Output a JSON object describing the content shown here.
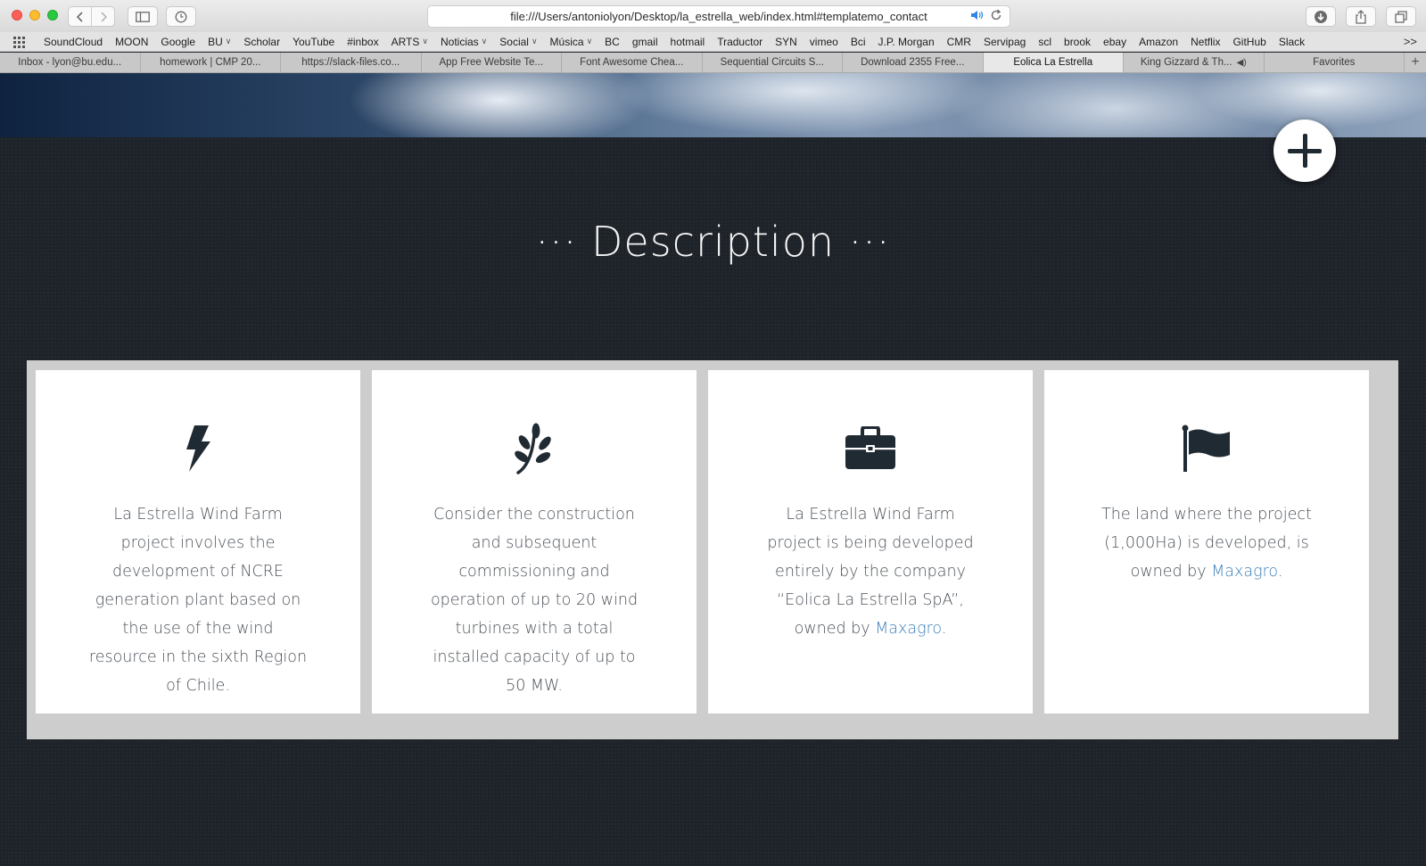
{
  "browser": {
    "url": "file:///Users/antoniolyon/Desktop/la_estrella_web/index.html#templatemo_contact",
    "bookmarks": [
      {
        "label": "SoundCloud",
        "menu": false
      },
      {
        "label": "MOON",
        "menu": false
      },
      {
        "label": "Google",
        "menu": false
      },
      {
        "label": "BU",
        "menu": true
      },
      {
        "label": "Scholar",
        "menu": false
      },
      {
        "label": "YouTube",
        "menu": false
      },
      {
        "label": "#inbox",
        "menu": false
      },
      {
        "label": "ARTS",
        "menu": true
      },
      {
        "label": "Noticias",
        "menu": true
      },
      {
        "label": "Social",
        "menu": true
      },
      {
        "label": "Música",
        "menu": true
      },
      {
        "label": "BC",
        "menu": false
      },
      {
        "label": "gmail",
        "menu": false
      },
      {
        "label": "hotmail",
        "menu": false
      },
      {
        "label": "Traductor",
        "menu": false
      },
      {
        "label": "SYN",
        "menu": false
      },
      {
        "label": "vimeo",
        "menu": false
      },
      {
        "label": "Bci",
        "menu": false
      },
      {
        "label": "J.P. Morgan",
        "menu": false
      },
      {
        "label": "CMR",
        "menu": false
      },
      {
        "label": "Servipag",
        "menu": false
      },
      {
        "label": "scl",
        "menu": false
      },
      {
        "label": "brook",
        "menu": false
      },
      {
        "label": "ebay",
        "menu": false
      },
      {
        "label": "Amazon",
        "menu": false
      },
      {
        "label": "Netflix",
        "menu": false
      },
      {
        "label": "GitHub",
        "menu": false
      },
      {
        "label": "Slack",
        "menu": false
      }
    ],
    "bookmarks_overflow": ">>",
    "tabs": [
      {
        "label": "Inbox - lyon@bu.edu...",
        "active": false,
        "audio": false
      },
      {
        "label": "homework | CMP 20...",
        "active": false,
        "audio": false
      },
      {
        "label": "https://slack-files.co...",
        "active": false,
        "audio": false
      },
      {
        "label": "App Free Website Te...",
        "active": false,
        "audio": false
      },
      {
        "label": "Font Awesome Chea...",
        "active": false,
        "audio": false
      },
      {
        "label": "Sequential Circuits S...",
        "active": false,
        "audio": false
      },
      {
        "label": "Download 2355 Free...",
        "active": false,
        "audio": false
      },
      {
        "label": "Eolica La Estrella",
        "active": true,
        "audio": false
      },
      {
        "label": "King Gizzard & Th...",
        "active": false,
        "audio": true
      },
      {
        "label": "Favorites",
        "active": false,
        "audio": false
      }
    ],
    "new_tab_label": "+"
  },
  "section": {
    "title": "··· Description ···"
  },
  "cards": [
    {
      "icon": "bolt-icon",
      "text": "La Estrella Wind Farm project involves the development of NCRE generation plant based on the use of the wind resource in the sixth Region of Chile.",
      "link": "",
      "suffix": ""
    },
    {
      "icon": "leaf-icon",
      "text": "Consider the construction and subsequent commissioning and operation of up to 20 wind turbines with a total installed capacity of up to 50 MW.",
      "link": "",
      "suffix": ""
    },
    {
      "icon": "briefcase-icon",
      "text": "La Estrella Wind Farm project is being developed entirely by the company “Eolica La Estrella SpA”, owned by ",
      "link": "Maxagro",
      "suffix": "."
    },
    {
      "icon": "flag-icon",
      "text": "The land where the project (1,000Ha) is developed, is owned by ",
      "link": "Maxagro",
      "suffix": "."
    }
  ],
  "colors": {
    "page_bg": "#1e2229",
    "panel": "#cdcdcd",
    "card": "#ffffff",
    "icon": "#1f2a33",
    "text": "#4b5158",
    "link": "#3d7fba"
  }
}
